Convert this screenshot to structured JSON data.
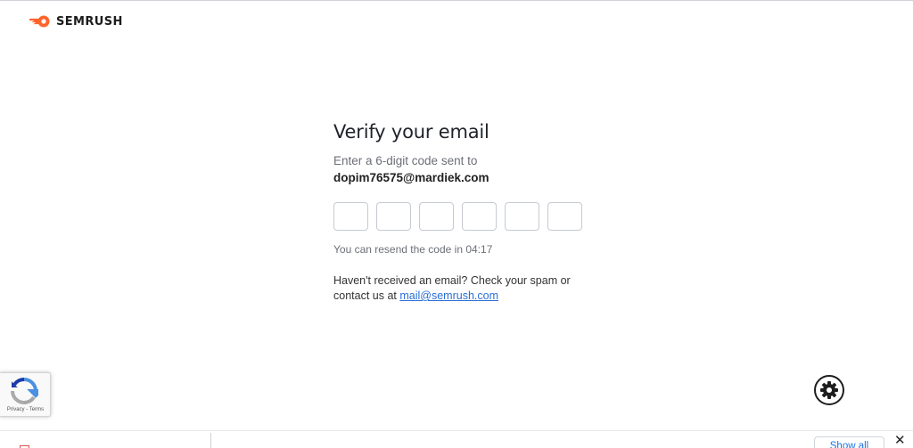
{
  "brand": {
    "name": "SEMRUSH",
    "accent": "#ff642d"
  },
  "verify": {
    "title": "Verify your email",
    "subtitle": "Enter a 6-digit code sent to",
    "email": "dopim76575@mardiek.com",
    "code_digits": [
      "",
      "",
      "",
      "",
      "",
      ""
    ],
    "resend_text": "You can resend the code in 04:17",
    "help_text": "Haven't received an email? Check your spam or contact us at",
    "help_link": "mail@semrush.com",
    "link_color": "#2b6fd6"
  },
  "recaptcha": {
    "links": "Privacy - Terms",
    "icon": "recaptcha-icon"
  },
  "settings": {
    "icon": "gear-icon"
  },
  "download_bar": {
    "file_name": "",
    "show_all_label": "Show all",
    "close_label": "✕"
  }
}
